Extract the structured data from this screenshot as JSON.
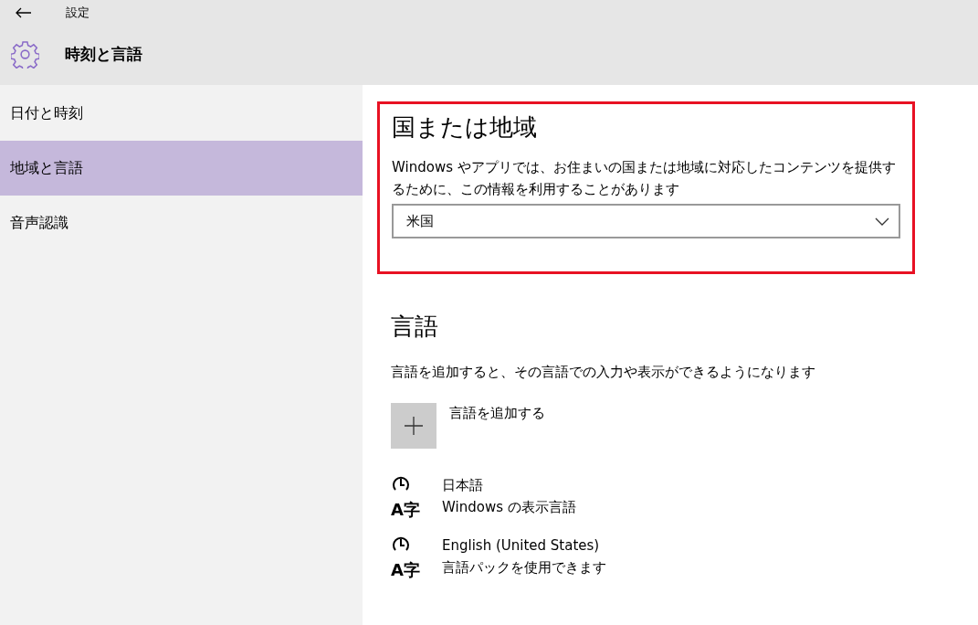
{
  "window": {
    "title": "設定"
  },
  "header": {
    "title": "時刻と言語"
  },
  "sidebar": {
    "items": [
      {
        "label": "日付と時刻",
        "selected": false
      },
      {
        "label": "地域と言語",
        "selected": true
      },
      {
        "label": "音声認識",
        "selected": false
      }
    ]
  },
  "region": {
    "heading": "国または地域",
    "description": "Windows やアプリでは、お住まいの国または地域に対応したコンテンツを提供するために、この情報を利用することがあります",
    "dropdown": {
      "value": "米国"
    }
  },
  "languages": {
    "heading": "言語",
    "description": "言語を追加すると、その言語での入力や表示ができるようになります",
    "add_label": "言語を追加する",
    "items": [
      {
        "icon_text": "A字",
        "name": "日本語",
        "status": "Windows の表示言語"
      },
      {
        "icon_text": "A字",
        "name": "English (United States)",
        "status": "言語パックを使用できます"
      }
    ]
  }
}
